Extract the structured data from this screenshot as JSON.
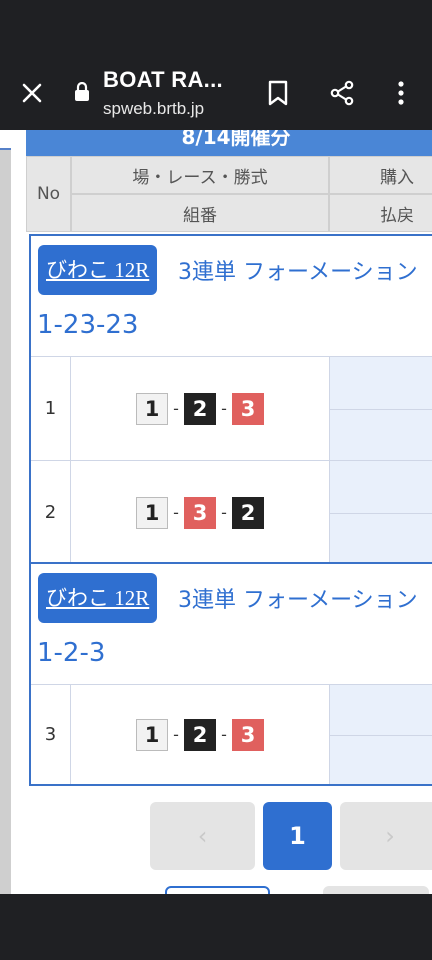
{
  "browser": {
    "title": "BOAT RA...",
    "url": "spweb.brtb.jp",
    "icons": [
      "close-icon",
      "lock-icon",
      "bookmark-icon",
      "share-icon",
      "more-vert-icon"
    ]
  },
  "page": {
    "date_header": "8/14開催分",
    "table_header": {
      "no": "No",
      "venue_race_type": "場・レース・勝式",
      "combination": "組番",
      "purchase": "購入",
      "payout": "払戻"
    },
    "cards": [
      {
        "venue_race": "びわこ 12R",
        "bet_type": "3連単 フォーメーション",
        "formation": "1-23-23",
        "rows": [
          {
            "no": "1",
            "n1": "1",
            "n2": "2",
            "n3": "3"
          },
          {
            "no": "2",
            "n1": "1",
            "n2": "3",
            "n3": "2"
          }
        ]
      },
      {
        "venue_race": "びわこ 12R",
        "bet_type": "3連単 フォーメーション",
        "formation": "1-2-3",
        "rows": [
          {
            "no": "3",
            "n1": "1",
            "n2": "2",
            "n3": "3"
          }
        ]
      }
    ],
    "pagination": {
      "prev": "‹",
      "current": "1",
      "next": "›"
    },
    "boat_colors": {
      "1": "#f2f2f2",
      "2": "#222222",
      "3": "#e0605e"
    },
    "accent": "#2f6fd0"
  }
}
